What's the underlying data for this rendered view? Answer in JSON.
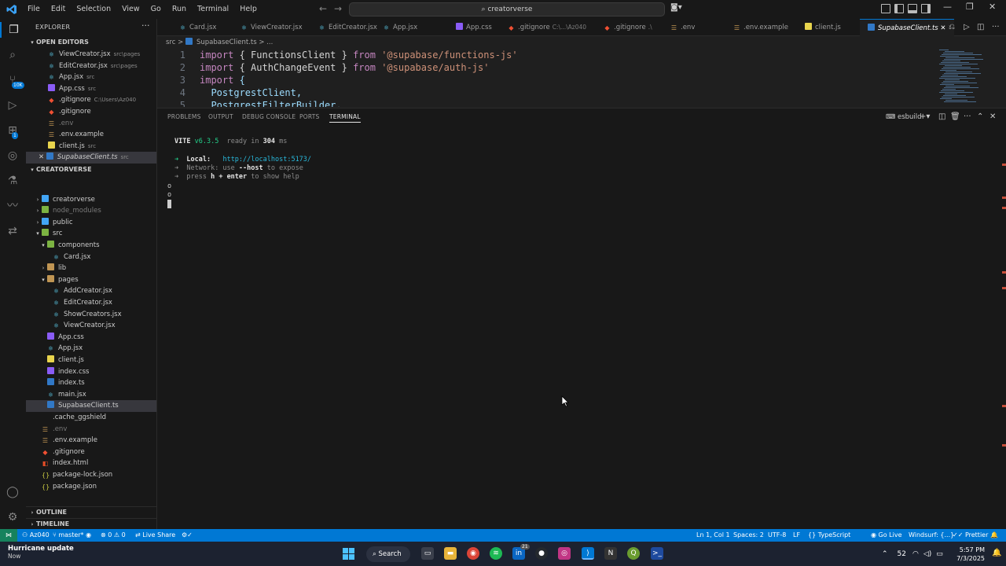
{
  "menu": [
    "File",
    "Edit",
    "Selection",
    "View",
    "Go",
    "Run",
    "Terminal",
    "Help"
  ],
  "command_center": "creatorverse",
  "explorer": {
    "title": "EXPLORER",
    "open_editors_label": "OPEN EDITORS",
    "open_editors": [
      {
        "name": "ViewCreator.jsx",
        "hint": "src\\pages",
        "icon": "react"
      },
      {
        "name": "EditCreator.jsx",
        "hint": "src\\pages",
        "icon": "react"
      },
      {
        "name": "App.jsx",
        "hint": "src",
        "icon": "react"
      },
      {
        "name": "App.css",
        "hint": "src",
        "icon": "css"
      },
      {
        "name": ".gitignore",
        "hint": "C:\\Users\\Az040",
        "icon": "git"
      },
      {
        "name": ".gitignore",
        "hint": "",
        "icon": "git"
      },
      {
        "name": ".env",
        "hint": "",
        "icon": "env"
      },
      {
        "name": ".env.example",
        "hint": "",
        "icon": "env"
      },
      {
        "name": "client.js",
        "hint": "src",
        "icon": "js"
      },
      {
        "name": "SupabaseClient.ts",
        "hint": "src",
        "icon": "ts"
      }
    ],
    "project_label": "CREATORVERSE",
    "tree": [
      {
        "name": "creatorverse",
        "type": "folder"
      },
      {
        "name": "node_modules",
        "type": "folder"
      },
      {
        "name": "public",
        "type": "folder"
      },
      {
        "name": "src",
        "type": "folder"
      },
      {
        "name": "components",
        "type": "folder"
      },
      {
        "name": "Card.jsx",
        "type": "react"
      },
      {
        "name": "lib",
        "type": "folder"
      },
      {
        "name": "pages",
        "type": "folder"
      },
      {
        "name": "AddCreator.jsx",
        "type": "react"
      },
      {
        "name": "EditCreator.jsx",
        "type": "react"
      },
      {
        "name": "ShowCreators.jsx",
        "type": "react"
      },
      {
        "name": "ViewCreator.jsx",
        "type": "react"
      },
      {
        "name": "App.css",
        "type": "css"
      },
      {
        "name": "App.jsx",
        "type": "react"
      },
      {
        "name": "client.js",
        "type": "js"
      },
      {
        "name": "index.css",
        "type": "css"
      },
      {
        "name": "index.ts",
        "type": "ts"
      },
      {
        "name": "main.jsx",
        "type": "react"
      },
      {
        "name": "SupabaseClient.ts",
        "type": "ts"
      },
      {
        "name": ".cache_ggshield",
        "type": "file"
      },
      {
        "name": ".env",
        "type": "env"
      },
      {
        "name": ".env.example",
        "type": "env"
      },
      {
        "name": ".gitignore",
        "type": "git"
      },
      {
        "name": "index.html",
        "type": "html"
      },
      {
        "name": "package-lock.json",
        "type": "json"
      },
      {
        "name": "package.json",
        "type": "json"
      }
    ],
    "outline_label": "OUTLINE",
    "timeline_label": "TIMELINE"
  },
  "tabs": [
    {
      "name": "Card.jsx",
      "hint": ""
    },
    {
      "name": "ViewCreator.jsx",
      "hint": ""
    },
    {
      "name": "EditCreator.jsx",
      "hint": ""
    },
    {
      "name": "App.jsx",
      "hint": ""
    },
    {
      "name": "App.css",
      "hint": ""
    },
    {
      "name": ".gitignore",
      "hint": "C:\\...\\Az040"
    },
    {
      "name": ".gitignore",
      "hint": ".\\"
    },
    {
      "name": ".env",
      "hint": ""
    },
    {
      "name": ".env.example",
      "hint": ""
    },
    {
      "name": "client.js",
      "hint": ""
    },
    {
      "name": "SupabaseClient.ts",
      "hint": ""
    }
  ],
  "breadcrumb": {
    "folder": "src",
    "sep": ">",
    "file": "SupabaseClient.ts",
    "more": "..."
  },
  "code": [
    {
      "n": "1",
      "a": "import",
      "b": " { FunctionsClient } ",
      "c": "from",
      "d": " '@supabase/functions-js'"
    },
    {
      "n": "2",
      "a": "import",
      "b": " { AuthChangeEvent } ",
      "c": "from",
      "d": " '@supabase/auth-js'"
    },
    {
      "n": "3",
      "a": "import",
      "b": " {",
      "c": "",
      "d": ""
    },
    {
      "n": "4",
      "a": "",
      "b": "  PostgrestClient,",
      "c": "",
      "d": ""
    },
    {
      "n": "5",
      "a": "",
      "b": "  PostgrestFilterBuilder,",
      "c": "",
      "d": ""
    }
  ],
  "panel": {
    "tabs": [
      "PROBLEMS",
      "OUTPUT",
      "DEBUG CONSOLE",
      "PORTS",
      "TERMINAL"
    ],
    "terminal_name": "esbuild"
  },
  "terminal": {
    "vite": "VITE",
    "version": "v6.3.5",
    "ready": "ready in",
    "ms_value": "304",
    "ms_unit": "ms",
    "arrow": "➜",
    "local_label": "Local:",
    "local_url": "http://localhost:5173/",
    "network_pre": "Network: use",
    "network_flag": "--host",
    "network_post": "to expose",
    "help_pre": "press",
    "help_key": "h + enter",
    "help_post": "to show help",
    "o1": "o",
    "o2": "o"
  },
  "status": {
    "user": "Az040",
    "branch": "master*",
    "problems": "0",
    "warnings": "0",
    "live_share": "Live Share",
    "position": "Ln 1, Col 1",
    "spaces": "Spaces: 2",
    "encoding": "UTF-8",
    "eol": "LF",
    "language": "TypeScript",
    "go_live": "Go Live",
    "windsurf": "Windsurf: {...}",
    "prettier": "Prettier"
  },
  "taskbar": {
    "weather_title": "Hurricane update",
    "weather_sub": "Now",
    "search": "Search",
    "temp": "52",
    "time": "5:57 PM",
    "date": "7/3/2025",
    "notif_badge": "21"
  },
  "activity_badges": {
    "source_control": "10K",
    "extensions": "1"
  },
  "colors": {
    "accent": "#0078d4",
    "terminal_green": "#23d18b",
    "terminal_cyan": "#29b8db"
  }
}
